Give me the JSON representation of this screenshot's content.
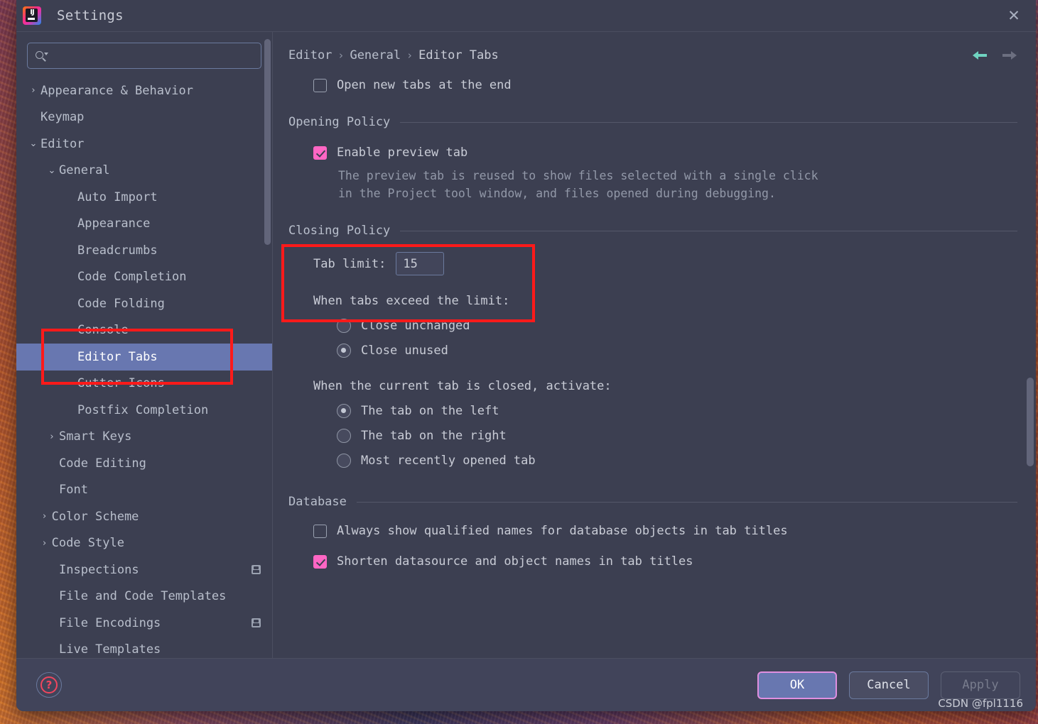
{
  "window": {
    "title": "Settings",
    "app_icon": "intellij-idea-icon",
    "icon_text": "IJ",
    "close_label": "✕"
  },
  "search": {
    "value": "",
    "placeholder": "",
    "icon": "search-icon"
  },
  "sidebar": {
    "items": [
      {
        "label": "Appearance & Behavior",
        "indent": 0,
        "arrow": "›",
        "expandable": true,
        "selected": false,
        "badge": false
      },
      {
        "label": "Keymap",
        "indent": 0,
        "arrow": "",
        "expandable": false,
        "selected": false,
        "badge": false
      },
      {
        "label": "Editor",
        "indent": 0,
        "arrow": "⌄",
        "expandable": true,
        "selected": false,
        "badge": false
      },
      {
        "label": "General",
        "indent": 1,
        "arrow": "⌄",
        "expandable": true,
        "selected": false,
        "badge": false
      },
      {
        "label": "Auto Import",
        "indent": 2,
        "arrow": "",
        "expandable": false,
        "selected": false,
        "badge": false
      },
      {
        "label": "Appearance",
        "indent": 2,
        "arrow": "",
        "expandable": false,
        "selected": false,
        "badge": false
      },
      {
        "label": "Breadcrumbs",
        "indent": 2,
        "arrow": "",
        "expandable": false,
        "selected": false,
        "badge": false
      },
      {
        "label": "Code Completion",
        "indent": 2,
        "arrow": "",
        "expandable": false,
        "selected": false,
        "badge": false
      },
      {
        "label": "Code Folding",
        "indent": 2,
        "arrow": "",
        "expandable": false,
        "selected": false,
        "badge": false
      },
      {
        "label": "Console",
        "indent": 2,
        "arrow": "",
        "expandable": false,
        "selected": false,
        "badge": false
      },
      {
        "label": "Editor Tabs",
        "indent": 2,
        "arrow": "",
        "expandable": false,
        "selected": true,
        "badge": false
      },
      {
        "label": "Gutter Icons",
        "indent": 2,
        "arrow": "",
        "expandable": false,
        "selected": false,
        "badge": false
      },
      {
        "label": "Postfix Completion",
        "indent": 2,
        "arrow": "",
        "expandable": false,
        "selected": false,
        "badge": false
      },
      {
        "label": "Smart Keys",
        "indent": 1,
        "arrow": "›",
        "expandable": true,
        "selected": false,
        "badge": false
      },
      {
        "label": "Code Editing",
        "indent": 1,
        "arrow": "",
        "expandable": false,
        "selected": false,
        "badge": false
      },
      {
        "label": "Font",
        "indent": 1,
        "arrow": "",
        "expandable": false,
        "selected": false,
        "badge": false
      },
      {
        "label": "Color Scheme",
        "indent": 0.6,
        "arrow": "›",
        "expandable": true,
        "selected": false,
        "badge": false
      },
      {
        "label": "Code Style",
        "indent": 0.6,
        "arrow": "›",
        "expandable": true,
        "selected": false,
        "badge": false
      },
      {
        "label": "Inspections",
        "indent": 1,
        "arrow": "",
        "expandable": false,
        "selected": false,
        "badge": true
      },
      {
        "label": "File and Code Templates",
        "indent": 1,
        "arrow": "",
        "expandable": false,
        "selected": false,
        "badge": false
      },
      {
        "label": "File Encodings",
        "indent": 1,
        "arrow": "",
        "expandable": false,
        "selected": false,
        "badge": true
      },
      {
        "label": "Live Templates",
        "indent": 1,
        "arrow": "",
        "expandable": false,
        "selected": false,
        "badge": false
      }
    ]
  },
  "breadcrumb": {
    "items": [
      "Editor",
      "General",
      "Editor Tabs"
    ],
    "separator": "›"
  },
  "nav": {
    "back_icon": "arrow-left-icon",
    "forward_icon": "arrow-right-icon",
    "back_enabled": true,
    "forward_enabled": false
  },
  "main": {
    "open_new_tabs": {
      "label": "Open new tabs at the end",
      "checked": false
    },
    "opening_policy": {
      "title": "Opening Policy",
      "enable_preview": {
        "label": "Enable preview tab",
        "checked": true
      },
      "description_line1": "The preview tab is reused to show files selected with a single click",
      "description_line2": "in the Project tool window, and files opened during debugging."
    },
    "closing_policy": {
      "title": "Closing Policy",
      "tab_limit_label": "Tab limit:",
      "tab_limit_value": "15",
      "exceed_label": "When tabs exceed the limit:",
      "exceed_options": [
        {
          "label": "Close unchanged",
          "selected": false
        },
        {
          "label": "Close unused",
          "selected": true
        }
      ],
      "activate_label": "When the current tab is closed, activate:",
      "activate_options": [
        {
          "label": "The tab on the left",
          "selected": true
        },
        {
          "label": "The tab on the right",
          "selected": false
        },
        {
          "label": "Most recently opened tab",
          "selected": false
        }
      ]
    },
    "database": {
      "title": "Database",
      "options": [
        {
          "label": "Always show qualified names for database objects in tab titles",
          "checked": false
        },
        {
          "label": "Shorten datasource and object names in tab titles",
          "checked": true
        }
      ]
    }
  },
  "footer": {
    "help_icon": "help-question-icon",
    "ok_label": "OK",
    "cancel_label": "Cancel",
    "apply_label": "Apply",
    "apply_enabled": false,
    "watermark": "CSDN @fpl1116"
  },
  "colors": {
    "dialog_bg": "#3c3f51",
    "selection": "#6877b0",
    "checkbox_accent": "#ff66c4",
    "annotation": "#ff1a1a",
    "back_arrow": "#6fd3c0",
    "help_accent": "#f0465e"
  }
}
